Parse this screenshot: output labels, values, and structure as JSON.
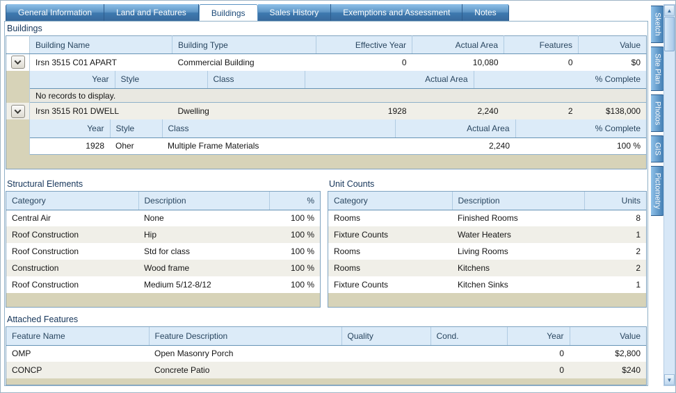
{
  "colors": {
    "tab_blue": "#3e7ab0",
    "header_blue": "#dcebf8",
    "filler_tan": "#d7d3b8",
    "title_navy": "#15355a"
  },
  "icons": {
    "scroll_up": "▲",
    "scroll_down": "▼"
  },
  "top_tabs": [
    {
      "label": "General Information",
      "active": false
    },
    {
      "label": "Land and Features",
      "active": false
    },
    {
      "label": "Buildings",
      "active": true
    },
    {
      "label": "Sales History",
      "active": false
    },
    {
      "label": "Exemptions and Assessment",
      "active": false
    },
    {
      "label": "Notes",
      "active": false
    }
  ],
  "side_tabs": [
    {
      "label": "Sketch"
    },
    {
      "label": "Site Plan"
    },
    {
      "label": "Photos"
    },
    {
      "label": "GIS"
    },
    {
      "label": "Pictometry"
    }
  ],
  "buildings": {
    "title": "Buildings",
    "columns": [
      "Building Name",
      "Building Type",
      "Effective Year",
      "Actual Area",
      "Features",
      "Value"
    ],
    "rows": [
      {
        "cells": [
          "Irsn 3515 C01 APART",
          "Commercial Building",
          "0",
          "10,080",
          "0",
          "$0"
        ],
        "detail": {
          "columns": [
            "Year",
            "Style",
            "Class",
            "Actual Area",
            "% Complete"
          ],
          "rows": [],
          "empty_text": "No records to display."
        }
      },
      {
        "cells": [
          "Irsn 3515 R01 DWELL",
          "Dwelling",
          "1928",
          "2,240",
          "2",
          "$138,000"
        ],
        "detail": {
          "columns": [
            "Year",
            "Style",
            "Class",
            "Actual Area",
            "% Complete"
          ],
          "rows": [
            [
              "1928",
              "Oher",
              "Multiple Frame Materials",
              "2,240",
              "100 %"
            ]
          ]
        }
      }
    ]
  },
  "structural_elements": {
    "title": "Structural Elements",
    "columns": [
      "Category",
      "Description",
      "%"
    ],
    "rows": [
      [
        "Central Air",
        "None",
        "100 %"
      ],
      [
        "Roof Construction",
        "Hip",
        "100 %"
      ],
      [
        "Roof Construction",
        "Std for class",
        "100 %"
      ],
      [
        "Construction",
        "Wood frame",
        "100 %"
      ],
      [
        "Roof Construction",
        "Medium 5/12-8/12",
        "100 %"
      ]
    ]
  },
  "unit_counts": {
    "title": "Unit Counts",
    "columns": [
      "Category",
      "Description",
      "Units"
    ],
    "rows": [
      [
        "Rooms",
        "Finished Rooms",
        "8"
      ],
      [
        "Fixture Counts",
        "Water Heaters",
        "1"
      ],
      [
        "Rooms",
        "Living Rooms",
        "2"
      ],
      [
        "Rooms",
        "Kitchens",
        "2"
      ],
      [
        "Fixture Counts",
        "Kitchen Sinks",
        "1"
      ]
    ]
  },
  "attached_features": {
    "title": "Attached Features",
    "columns": [
      "Feature Name",
      "Feature Description",
      "Quality",
      "Cond.",
      "Year",
      "Value"
    ],
    "rows": [
      [
        "OMP",
        "Open Masonry Porch",
        "",
        "",
        "0",
        "$2,800"
      ],
      [
        "CONCP",
        "Concrete Patio",
        "",
        "",
        "0",
        "$240"
      ]
    ]
  }
}
